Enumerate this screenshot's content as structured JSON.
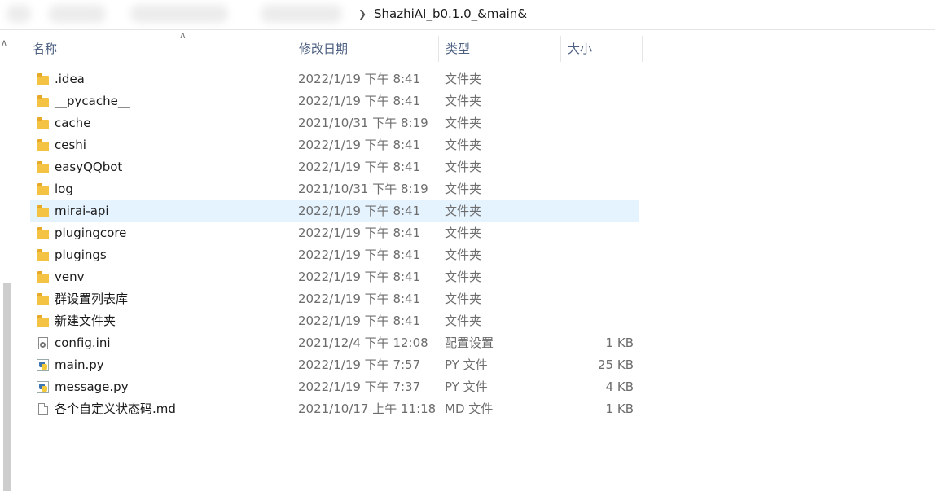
{
  "address_bar": {
    "path_current": "ShazhiAI_b0.1.0_&main&"
  },
  "columns": {
    "name": "名称",
    "date": "修改日期",
    "type": "类型",
    "size": "大小"
  },
  "files": [
    {
      "name": ".idea",
      "date": "2022/1/19 下午 8:41",
      "type": "文件夹",
      "size": "",
      "icon": "folder-icon"
    },
    {
      "name": "__pycache__",
      "date": "2022/1/19 下午 8:41",
      "type": "文件夹",
      "size": "",
      "icon": "folder-icon"
    },
    {
      "name": "cache",
      "date": "2021/10/31 下午 8:19",
      "type": "文件夹",
      "size": "",
      "icon": "folder-icon"
    },
    {
      "name": "ceshi",
      "date": "2022/1/19 下午 8:41",
      "type": "文件夹",
      "size": "",
      "icon": "folder-icon"
    },
    {
      "name": "easyQQbot",
      "date": "2022/1/19 下午 8:41",
      "type": "文件夹",
      "size": "",
      "icon": "folder-icon"
    },
    {
      "name": "log",
      "date": "2021/10/31 下午 8:19",
      "type": "文件夹",
      "size": "",
      "icon": "folder-icon"
    },
    {
      "name": "mirai-api",
      "date": "2022/1/19 下午 8:41",
      "type": "文件夹",
      "size": "",
      "icon": "folder-icon",
      "selected": true
    },
    {
      "name": "plugingcore",
      "date": "2022/1/19 下午 8:41",
      "type": "文件夹",
      "size": "",
      "icon": "folder-icon"
    },
    {
      "name": "plugings",
      "date": "2022/1/19 下午 8:41",
      "type": "文件夹",
      "size": "",
      "icon": "folder-icon"
    },
    {
      "name": "venv",
      "date": "2022/1/19 下午 8:41",
      "type": "文件夹",
      "size": "",
      "icon": "folder-icon"
    },
    {
      "name": "群设置列表库",
      "date": "2022/1/19 下午 8:41",
      "type": "文件夹",
      "size": "",
      "icon": "folder-icon"
    },
    {
      "name": "新建文件夹",
      "date": "2022/1/19 下午 8:41",
      "type": "文件夹",
      "size": "",
      "icon": "folder-icon"
    },
    {
      "name": "config.ini",
      "date": "2021/12/4 下午 12:08",
      "type": "配置设置",
      "size": "1 KB",
      "icon": "settings-file-icon"
    },
    {
      "name": "main.py",
      "date": "2022/1/19 下午 7:57",
      "type": "PY 文件",
      "size": "25 KB",
      "icon": "python-file-icon"
    },
    {
      "name": "message.py",
      "date": "2022/1/19 下午 7:37",
      "type": "PY 文件",
      "size": "4 KB",
      "icon": "python-file-icon"
    },
    {
      "name": "各个自定义状态码.md",
      "date": "2021/10/17 上午 11:18",
      "type": "MD 文件",
      "size": "1 KB",
      "icon": "document-file-icon"
    }
  ]
}
